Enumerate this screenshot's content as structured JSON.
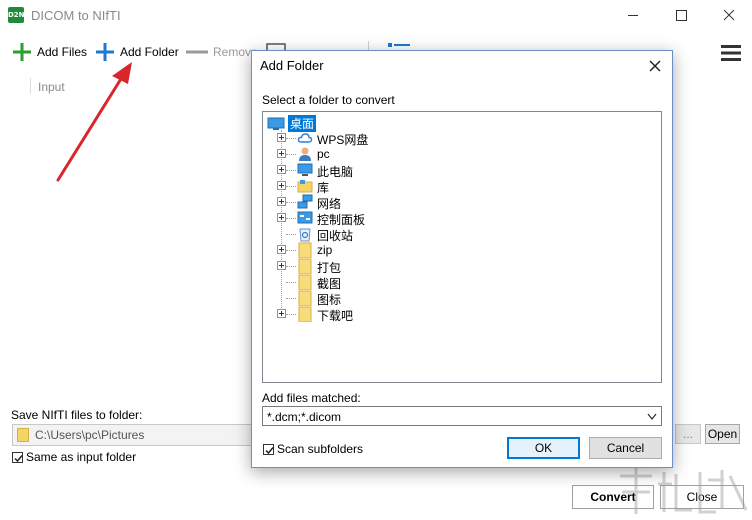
{
  "app": {
    "title": "DICOM to NIfTI",
    "icon_text": "D2N"
  },
  "toolbar": {
    "add_files": "Add Files",
    "add_folder": "Add Folder",
    "remove": "Remove"
  },
  "list": {
    "column_input": "Input"
  },
  "output": {
    "save_label": "Save NIfTI files to folder:",
    "path": "C:\\Users\\pc\\Pictures",
    "same_as_input": "Same as input folder",
    "same_as_input_checked": true,
    "browse_label": "...",
    "open_label": "Open"
  },
  "actions": {
    "convert": "Convert",
    "close": "Close"
  },
  "dialog": {
    "title": "Add Folder",
    "select_label": "Select a folder to convert",
    "tree": {
      "root": "桌面",
      "items": [
        {
          "label": "WPS网盘",
          "icon": "cloud-icon",
          "expandable": true
        },
        {
          "label": "pc",
          "icon": "user-icon",
          "expandable": true
        },
        {
          "label": "此电脑",
          "icon": "computer-icon",
          "expandable": true
        },
        {
          "label": "库",
          "icon": "library-icon",
          "expandable": true
        },
        {
          "label": "网络",
          "icon": "network-icon",
          "expandable": true
        },
        {
          "label": "控制面板",
          "icon": "control-panel-icon",
          "expandable": true
        },
        {
          "label": "回收站",
          "icon": "recycle-bin-icon",
          "expandable": false
        },
        {
          "label": "zip",
          "icon": "folder-icon",
          "expandable": true
        },
        {
          "label": "打包",
          "icon": "folder-icon",
          "expandable": true
        },
        {
          "label": "截图",
          "icon": "folder-icon",
          "expandable": false
        },
        {
          "label": "图标",
          "icon": "folder-icon",
          "expandable": false
        },
        {
          "label": "下载吧",
          "icon": "folder-icon",
          "expandable": true
        }
      ]
    },
    "match_label": "Add files matched:",
    "match_value": "*.dcm;*.dicom",
    "scan_subfolders": "Scan subfolders",
    "scan_subfolders_checked": true,
    "ok": "OK",
    "cancel": "Cancel"
  },
  "colors": {
    "accent": "#0078d7",
    "add_icon": "#2aa02a",
    "annotation_arrow": "#d9262b"
  }
}
